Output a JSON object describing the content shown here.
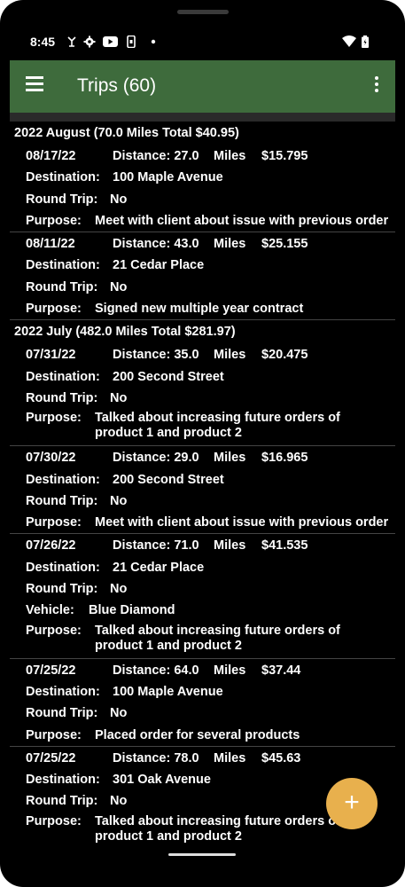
{
  "status": {
    "time": "8:45"
  },
  "header": {
    "title": "Trips (60)"
  },
  "labels": {
    "distance": "Distance:",
    "miles": "Miles",
    "destination": "Destination:",
    "round_trip": "Round Trip:",
    "purpose": "Purpose:",
    "vehicle": "Vehicle:"
  },
  "groups": [
    {
      "header": "2022 August (70.0 Miles Total $40.95)",
      "trips": [
        {
          "date": "08/17/22",
          "distance": "27.0",
          "amount": "$15.795",
          "destination": "100 Maple Avenue",
          "round_trip": "No",
          "purpose": "Meet with client about issue with previous order"
        },
        {
          "date": "08/11/22",
          "distance": "43.0",
          "amount": "$25.155",
          "destination": "21 Cedar Place",
          "round_trip": "No",
          "purpose": "Signed new multiple year contract"
        }
      ]
    },
    {
      "header": "2022 July (482.0 Miles Total $281.97)",
      "trips": [
        {
          "date": "07/31/22",
          "distance": "35.0",
          "amount": "$20.475",
          "destination": "200 Second Street",
          "round_trip": "No",
          "purpose": "Talked about increasing future orders of product 1 and product 2"
        },
        {
          "date": "07/30/22",
          "distance": "29.0",
          "amount": "$16.965",
          "destination": "200 Second Street",
          "round_trip": "No",
          "purpose": "Meet with client about issue with previous order"
        },
        {
          "date": "07/26/22",
          "distance": "71.0",
          "amount": "$41.535",
          "destination": "21 Cedar Place",
          "round_trip": "No",
          "vehicle": "Blue Diamond",
          "purpose": "Talked about increasing future orders of product 1 and product 2"
        },
        {
          "date": "07/25/22",
          "distance": "64.0",
          "amount": "$37.44",
          "destination": "100 Maple Avenue",
          "round_trip": "No",
          "purpose": "Placed order for several products"
        },
        {
          "date": "07/25/22",
          "distance": "78.0",
          "amount": "$45.63",
          "destination": "301 Oak Avenue",
          "round_trip": "No",
          "purpose": "Talked about increasing future orders of product 1 and product 2"
        }
      ]
    }
  ],
  "fab": {
    "icon": "plus-icon",
    "label": "+"
  }
}
